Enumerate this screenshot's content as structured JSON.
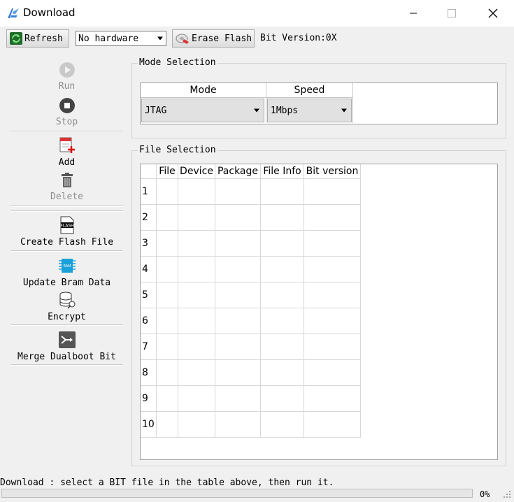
{
  "window": {
    "title": "Download",
    "colors": {
      "accent": "#4a90d9",
      "titlebar": "#ffffff"
    }
  },
  "toolbar": {
    "refresh_label": "Refresh",
    "hardware_value": "No hardware",
    "erase_label": "Erase Flash",
    "bit_version": "Bit Version:0X"
  },
  "sidebar": {
    "run": "Run",
    "stop": "Stop",
    "add": "Add",
    "delete": "Delete",
    "create_flash": "Create Flash File",
    "update_bram": "Update Bram Data",
    "encrypt": "Encrypt",
    "merge": "Merge Dualboot Bit"
  },
  "mode_selection": {
    "title": "Mode Selection",
    "headers": [
      "Mode",
      "Speed"
    ],
    "mode_value": "JTAG",
    "speed_value": "1Mbps"
  },
  "file_selection": {
    "title": "File Selection",
    "headers": [
      "File",
      "Device",
      "Package",
      "File Info",
      "Bit version"
    ],
    "rows": [
      "1",
      "2",
      "3",
      "4",
      "5",
      "6",
      "7",
      "8",
      "9",
      "10"
    ]
  },
  "status": {
    "message": "Download : select a BIT file in the table above, then run it.",
    "progress_percent": 0,
    "progress_label": "0%"
  }
}
